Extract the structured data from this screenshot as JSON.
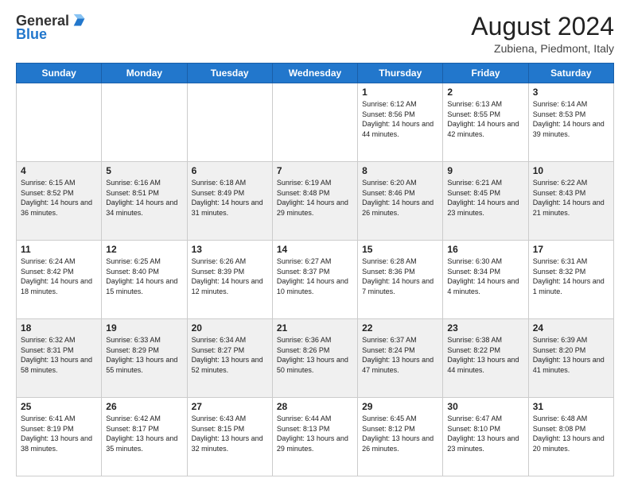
{
  "header": {
    "logo": {
      "general": "General",
      "blue": "Blue"
    },
    "title": "August 2024",
    "location": "Zubiena, Piedmont, Italy"
  },
  "days_of_week": [
    "Sunday",
    "Monday",
    "Tuesday",
    "Wednesday",
    "Thursday",
    "Friday",
    "Saturday"
  ],
  "weeks": [
    [
      {
        "day": "",
        "info": ""
      },
      {
        "day": "",
        "info": ""
      },
      {
        "day": "",
        "info": ""
      },
      {
        "day": "",
        "info": ""
      },
      {
        "day": "1",
        "info": "Sunrise: 6:12 AM\nSunset: 8:56 PM\nDaylight: 14 hours and 44 minutes."
      },
      {
        "day": "2",
        "info": "Sunrise: 6:13 AM\nSunset: 8:55 PM\nDaylight: 14 hours and 42 minutes."
      },
      {
        "day": "3",
        "info": "Sunrise: 6:14 AM\nSunset: 8:53 PM\nDaylight: 14 hours and 39 minutes."
      }
    ],
    [
      {
        "day": "4",
        "info": "Sunrise: 6:15 AM\nSunset: 8:52 PM\nDaylight: 14 hours and 36 minutes."
      },
      {
        "day": "5",
        "info": "Sunrise: 6:16 AM\nSunset: 8:51 PM\nDaylight: 14 hours and 34 minutes."
      },
      {
        "day": "6",
        "info": "Sunrise: 6:18 AM\nSunset: 8:49 PM\nDaylight: 14 hours and 31 minutes."
      },
      {
        "day": "7",
        "info": "Sunrise: 6:19 AM\nSunset: 8:48 PM\nDaylight: 14 hours and 29 minutes."
      },
      {
        "day": "8",
        "info": "Sunrise: 6:20 AM\nSunset: 8:46 PM\nDaylight: 14 hours and 26 minutes."
      },
      {
        "day": "9",
        "info": "Sunrise: 6:21 AM\nSunset: 8:45 PM\nDaylight: 14 hours and 23 minutes."
      },
      {
        "day": "10",
        "info": "Sunrise: 6:22 AM\nSunset: 8:43 PM\nDaylight: 14 hours and 21 minutes."
      }
    ],
    [
      {
        "day": "11",
        "info": "Sunrise: 6:24 AM\nSunset: 8:42 PM\nDaylight: 14 hours and 18 minutes."
      },
      {
        "day": "12",
        "info": "Sunrise: 6:25 AM\nSunset: 8:40 PM\nDaylight: 14 hours and 15 minutes."
      },
      {
        "day": "13",
        "info": "Sunrise: 6:26 AM\nSunset: 8:39 PM\nDaylight: 14 hours and 12 minutes."
      },
      {
        "day": "14",
        "info": "Sunrise: 6:27 AM\nSunset: 8:37 PM\nDaylight: 14 hours and 10 minutes."
      },
      {
        "day": "15",
        "info": "Sunrise: 6:28 AM\nSunset: 8:36 PM\nDaylight: 14 hours and 7 minutes."
      },
      {
        "day": "16",
        "info": "Sunrise: 6:30 AM\nSunset: 8:34 PM\nDaylight: 14 hours and 4 minutes."
      },
      {
        "day": "17",
        "info": "Sunrise: 6:31 AM\nSunset: 8:32 PM\nDaylight: 14 hours and 1 minute."
      }
    ],
    [
      {
        "day": "18",
        "info": "Sunrise: 6:32 AM\nSunset: 8:31 PM\nDaylight: 13 hours and 58 minutes."
      },
      {
        "day": "19",
        "info": "Sunrise: 6:33 AM\nSunset: 8:29 PM\nDaylight: 13 hours and 55 minutes."
      },
      {
        "day": "20",
        "info": "Sunrise: 6:34 AM\nSunset: 8:27 PM\nDaylight: 13 hours and 52 minutes."
      },
      {
        "day": "21",
        "info": "Sunrise: 6:36 AM\nSunset: 8:26 PM\nDaylight: 13 hours and 50 minutes."
      },
      {
        "day": "22",
        "info": "Sunrise: 6:37 AM\nSunset: 8:24 PM\nDaylight: 13 hours and 47 minutes."
      },
      {
        "day": "23",
        "info": "Sunrise: 6:38 AM\nSunset: 8:22 PM\nDaylight: 13 hours and 44 minutes."
      },
      {
        "day": "24",
        "info": "Sunrise: 6:39 AM\nSunset: 8:20 PM\nDaylight: 13 hours and 41 minutes."
      }
    ],
    [
      {
        "day": "25",
        "info": "Sunrise: 6:41 AM\nSunset: 8:19 PM\nDaylight: 13 hours and 38 minutes."
      },
      {
        "day": "26",
        "info": "Sunrise: 6:42 AM\nSunset: 8:17 PM\nDaylight: 13 hours and 35 minutes."
      },
      {
        "day": "27",
        "info": "Sunrise: 6:43 AM\nSunset: 8:15 PM\nDaylight: 13 hours and 32 minutes."
      },
      {
        "day": "28",
        "info": "Sunrise: 6:44 AM\nSunset: 8:13 PM\nDaylight: 13 hours and 29 minutes."
      },
      {
        "day": "29",
        "info": "Sunrise: 6:45 AM\nSunset: 8:12 PM\nDaylight: 13 hours and 26 minutes."
      },
      {
        "day": "30",
        "info": "Sunrise: 6:47 AM\nSunset: 8:10 PM\nDaylight: 13 hours and 23 minutes."
      },
      {
        "day": "31",
        "info": "Sunrise: 6:48 AM\nSunset: 8:08 PM\nDaylight: 13 hours and 20 minutes."
      }
    ]
  ]
}
